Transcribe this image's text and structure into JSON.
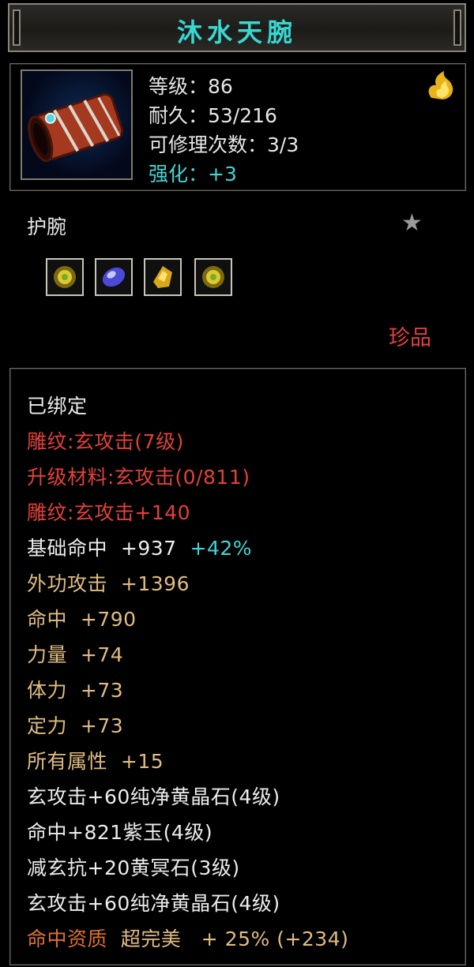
{
  "title": "沐水天腕",
  "colors": {
    "title": "#36d8d4",
    "red": "#e3403a",
    "gold": "#e0bc82",
    "cyan": "#3fd6d6",
    "orange": "#e0702c"
  },
  "header": {
    "level": "等级：86",
    "durability": "耐久：53/216",
    "repairs": "可修理次数：3/3",
    "enhance": "强化：+3"
  },
  "slot_name": "护腕",
  "quality": "珍品",
  "gems": [
    "yellow-green-gem-icon",
    "purple-gem-icon",
    "yellow-gem-icon",
    "yellow-green-gem-icon"
  ],
  "attributes": {
    "bound": "已绑定",
    "engrave1": "雕纹:玄攻击(7级)",
    "upgrade": "升级材料:玄攻击(0/811)",
    "engrave2": "雕纹:玄攻击+140",
    "base_hit_label": "基础命中",
    "base_hit_value": "+937",
    "base_hit_pct": "+42%",
    "outer_attack_label": "外功攻击",
    "outer_attack_value": "+1396",
    "hit_label": "命中",
    "hit_value": "+790",
    "strength_label": "力量",
    "strength_value": "+74",
    "stamina_label": "体力",
    "stamina_value": "+73",
    "focus_label": "定力",
    "focus_value": "+73",
    "all_attr_label": "所有属性",
    "all_attr_value": "+15",
    "gem1": "玄攻击+60纯净黄晶石(4级)",
    "gem2": "命中+821紫玉(4级)",
    "gem3": "减玄抗+20黄冥石(3级)",
    "gem4": "玄攻击+60纯净黄晶石(4级)",
    "aptitude_label": "命中资质",
    "aptitude_grade": "超完美",
    "aptitude_value": "+ 25% (+234)"
  }
}
